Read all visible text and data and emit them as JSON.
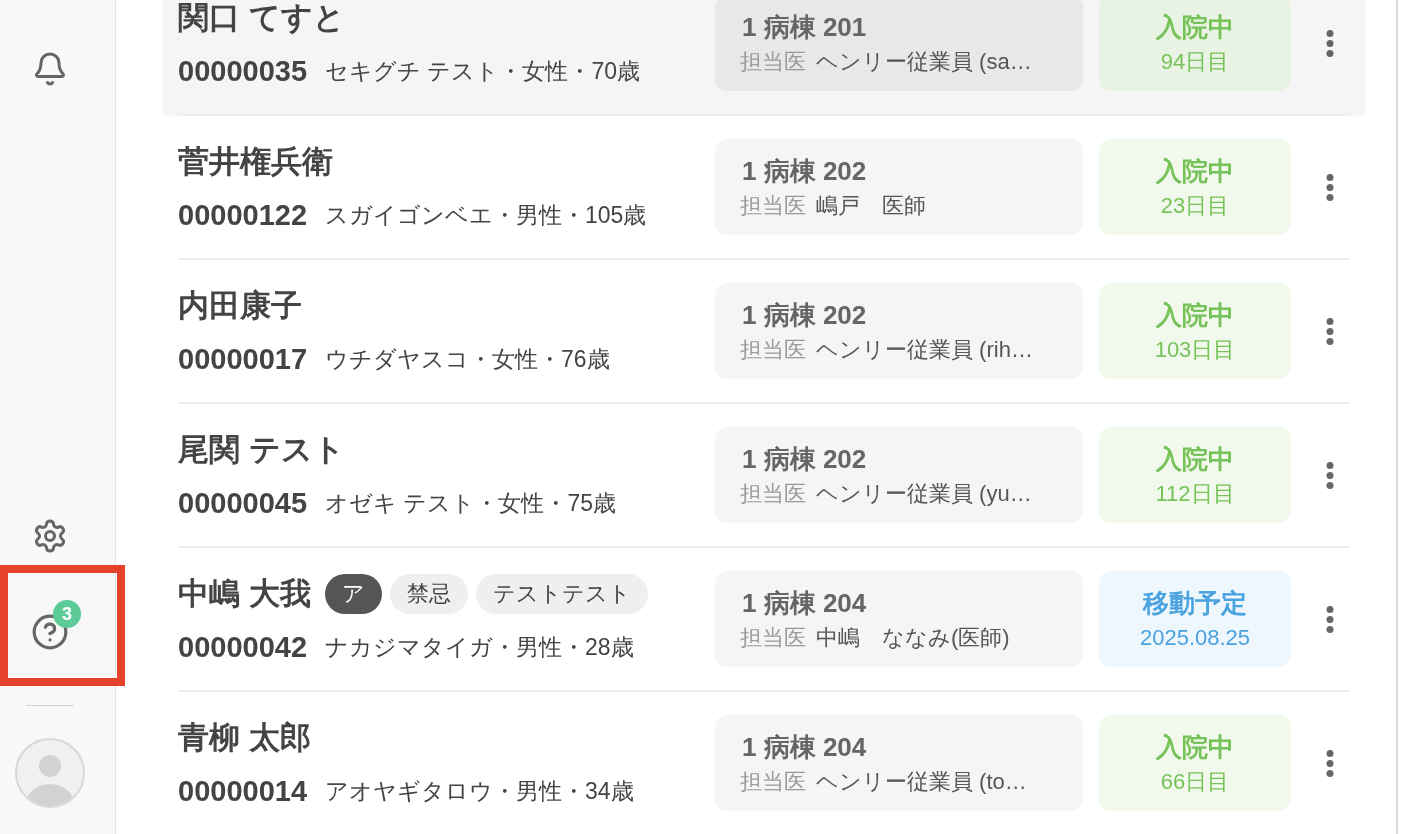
{
  "sidebar": {
    "top": [
      {
        "kind": "notifications",
        "highlighted": false
      }
    ],
    "bottom": [
      {
        "kind": "settings",
        "highlighted": false
      },
      {
        "kind": "help",
        "badge": "3",
        "highlighted": true
      }
    ]
  },
  "patients": [
    {
      "name": "関口 てすと",
      "id": "00000035",
      "details": "セキグチ テスト・女性・70歳",
      "ward": "1 病棟 201",
      "doctor_label": "担当医",
      "doctor": "ヘンリー従業員 (sa…",
      "status": {
        "kind": "admitted",
        "label": "入院中",
        "sub": "94日目"
      },
      "hovered": true
    },
    {
      "name": "菅井権兵衛",
      "id": "00000122",
      "details": "スガイゴンベエ・男性・105歳",
      "ward": "1 病棟 202",
      "doctor_label": "担当医",
      "doctor": "嶋戸　医師",
      "status": {
        "kind": "admitted",
        "label": "入院中",
        "sub": "23日目"
      },
      "hovered": false
    },
    {
      "name": "内田康子",
      "id": "00000017",
      "details": "ウチダヤスコ・女性・76歳",
      "ward": "1 病棟 202",
      "doctor_label": "担当医",
      "doctor": "ヘンリー従業員 (rih…",
      "status": {
        "kind": "admitted",
        "label": "入院中",
        "sub": "103日目"
      },
      "hovered": false
    },
    {
      "name": "尾関 テスト",
      "id": "00000045",
      "details": "オゼキ テスト・女性・75歳",
      "ward": "1 病棟 202",
      "doctor_label": "担当医",
      "doctor": "ヘンリー従業員 (yu…",
      "status": {
        "kind": "admitted",
        "label": "入院中",
        "sub": "112日目"
      },
      "hovered": false
    },
    {
      "name": "中嶋 大我",
      "tags": [
        {
          "label": "ア",
          "kind": "filled"
        },
        {
          "label": "禁忌",
          "kind": "plain"
        },
        {
          "label": "テストテスト",
          "kind": "plain"
        }
      ],
      "id": "00000042",
      "details": "ナカジマタイガ・男性・28歳",
      "ward": "1 病棟 204",
      "doctor_label": "担当医",
      "doctor": "中嶋　ななみ(医師)",
      "status": {
        "kind": "transfer",
        "label": "移動予定",
        "sub": "2025.08.25"
      },
      "hovered": false
    },
    {
      "name": "青柳 太郎",
      "id": "00000014",
      "details": "アオヤギタロウ・男性・34歳",
      "ward": "1 病棟 204",
      "doctor_label": "担当医",
      "doctor": "ヘンリー従業員 (to…",
      "status": {
        "kind": "admitted",
        "label": "入院中",
        "sub": "66日目"
      },
      "hovered": false
    }
  ]
}
